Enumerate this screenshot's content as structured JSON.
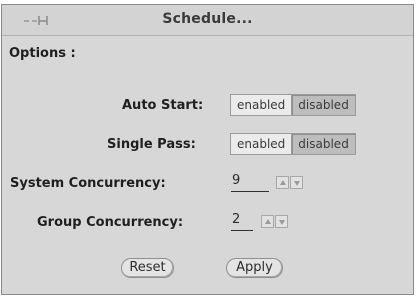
{
  "window": {
    "title": "Schedule..."
  },
  "options": {
    "label": "Options :"
  },
  "auto_start": {
    "label": "Auto Start:",
    "enabled": "enabled",
    "disabled": "disabled",
    "selected": "disabled"
  },
  "single_pass": {
    "label": "Single Pass:",
    "enabled": "enabled",
    "disabled": "disabled",
    "selected": "disabled"
  },
  "system_concurrency": {
    "label": "System Concurrency:",
    "value": "9"
  },
  "group_concurrency": {
    "label": "Group Concurrency:",
    "value": "2"
  },
  "buttons": {
    "reset": "Reset",
    "apply": "Apply"
  },
  "icons": {
    "pin": "pushpin-icon",
    "up": "increment-arrow-icon",
    "down": "decrement-arrow-icon"
  }
}
